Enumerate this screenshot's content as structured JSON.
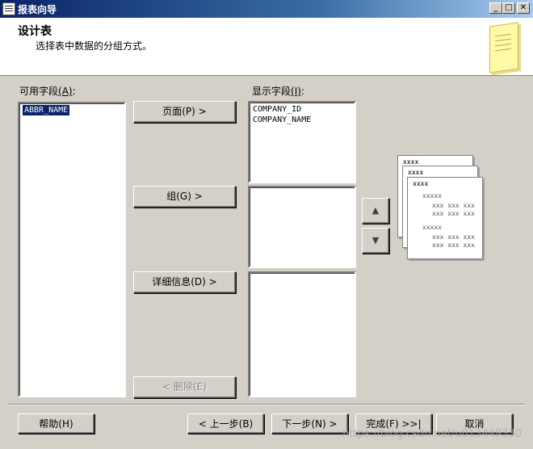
{
  "window": {
    "title": "报表向导",
    "controls": [
      "_",
      "□",
      "✕"
    ]
  },
  "header": {
    "title": "设计表",
    "subtitle": "选择表中数据的分组方式。"
  },
  "available_fields": {
    "label": "可用字段",
    "accel": "(A)",
    "items": [
      "ABBR_NAME"
    ]
  },
  "displayed_fields": {
    "label": "显示字段",
    "accel": "(I)",
    "page_items": [
      "COMPANY_ID",
      "COMPANY_NAME"
    ],
    "group_items": [],
    "detail_items": []
  },
  "buttons": {
    "page": "页面(P) >",
    "group": "组(G) >",
    "details": "详细信息(D) >",
    "remove": "< 删除(E)",
    "move_up": "▲",
    "move_down": "▼",
    "help": "帮助(H)",
    "back": "< 上一步(B)",
    "next": "下一步(N) >",
    "finish": "完成(F) >>|",
    "cancel": "取消"
  },
  "preview": {
    "header": "xxxx",
    "group": "xxxxx",
    "detail": "xxx xxx xxx"
  },
  "watermark": "https://blog.csdn.net/u013449330"
}
